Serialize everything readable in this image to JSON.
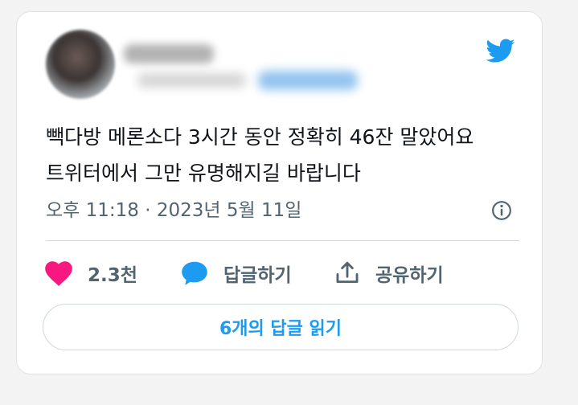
{
  "tweet": {
    "text_lines": [
      "빽다방 메론소다 3시간 동안 정확히 46잔 말았어요",
      "트위터에서 그만 유명해지길 바랍니다"
    ],
    "timestamp": "오후 11:18 · 2023년 5월 11일"
  },
  "actions": {
    "like_count": "2.3천",
    "reply_label": "답글하기",
    "share_label": "공유하기"
  },
  "read_replies_label": "6개의 답글 읽기",
  "icons": {
    "brand": "twitter-bird-icon",
    "info": "info-icon",
    "like": "heart-icon",
    "reply": "speech-bubble-icon",
    "share": "share-upload-icon"
  },
  "colors": {
    "brand_blue": "#1d9bf0",
    "like_pink": "#f91880",
    "muted_text": "#536471",
    "text": "#0f1419"
  }
}
